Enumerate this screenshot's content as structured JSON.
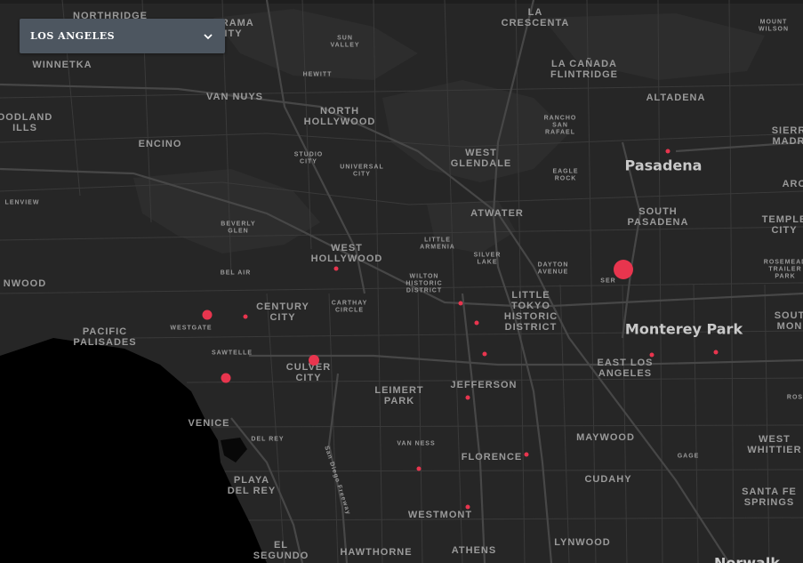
{
  "selector": {
    "value": "LOS ANGELES"
  },
  "colors": {
    "water": "#000000",
    "land": "#262626",
    "road": "#3a3a3a",
    "road_major": "#444444",
    "park": "#2e2e2e",
    "label": "#9a9a9a",
    "label_strong": "#c9c9c9",
    "marker": "#e8354e"
  },
  "labels": [
    {
      "t": "NORTHRIDGE"
    },
    {
      "t": "NORAMA\nCITY"
    },
    {
      "t": "WINNETKA"
    },
    {
      "t": "SUN\nVALLEY"
    },
    {
      "t": "LA\nCRESCENTA"
    },
    {
      "t": "MOUNT\nWILSON"
    },
    {
      "t": "HEWITT"
    },
    {
      "t": "VAN NUYS"
    },
    {
      "t": "LA CAÑADA\nFLINTRIDGE"
    },
    {
      "t": "ALTADENA"
    },
    {
      "t": "OODLAND\nILLS"
    },
    {
      "t": "NORTH\nHOLLYWOOD"
    },
    {
      "t": "RANCHO\nSAN\nRAFAEL"
    },
    {
      "t": "SIERR\nMADR"
    },
    {
      "t": "ENCINO"
    },
    {
      "t": "STUDIO\nCITY"
    },
    {
      "t": "UNIVERSAL\nCITY"
    },
    {
      "t": "WEST\nGLENDALE"
    },
    {
      "t": "Pasadena"
    },
    {
      "t": "EAGLE\nROCK"
    },
    {
      "t": "ARC"
    },
    {
      "t": "LENVIEW"
    },
    {
      "t": "ATWATER"
    },
    {
      "t": "SOUTH\nPASADENA"
    },
    {
      "t": "TEMPLE\nCITY"
    },
    {
      "t": "BEVERLY\nGLEN"
    },
    {
      "t": "LITTLE\nARMENIA"
    },
    {
      "t": "WEST\nHOLLYWOOD"
    },
    {
      "t": "SILVER\nLAKE"
    },
    {
      "t": "DAYTON\nAVENUE"
    },
    {
      "t": "ROSEMEAD\nTRAILER\nPARK"
    },
    {
      "t": "BEL AIR"
    },
    {
      "t": "NWOOD"
    },
    {
      "t": "WILTON\nHISTORIC\nDISTRICT"
    },
    {
      "t": "SER"
    },
    {
      "t": "CENTURY\nCITY"
    },
    {
      "t": "CARTHAY\nCIRCLE"
    },
    {
      "t": "LITTLE\nTOKYO\nHISTORIC\nDISTRICT"
    },
    {
      "t": "Monterey Park"
    },
    {
      "t": "SOUT\nMON"
    },
    {
      "t": "PACIFIC\nPALISADES"
    },
    {
      "t": "WESTGATE"
    },
    {
      "t": "SAWTELLE"
    },
    {
      "t": "CULVER\nCITY"
    },
    {
      "t": "EAST LOS\nANGELES"
    },
    {
      "t": "JEFFERSON"
    },
    {
      "t": "LEIMERT\nPARK"
    },
    {
      "t": "ROS"
    },
    {
      "t": "VENICE"
    },
    {
      "t": "DEL REY"
    },
    {
      "t": "MAYWOOD"
    },
    {
      "t": "VAN NESS"
    },
    {
      "t": "WEST\nWHITTIER"
    },
    {
      "t": "FLORENCE"
    },
    {
      "t": "GAGE"
    },
    {
      "t": "San Diego Freeway"
    },
    {
      "t": "CUDAHY"
    },
    {
      "t": "PLAYA\nDEL REY"
    },
    {
      "t": "SANTA FE\nSPRINGS"
    },
    {
      "t": "WESTMONT"
    },
    {
      "t": "LYNWOOD"
    },
    {
      "t": "EL\nSEGUNDO"
    },
    {
      "t": "HAWTHORNE"
    },
    {
      "t": "ATHENS"
    },
    {
      "t": "Norwalk"
    }
  ],
  "markers_count": 17
}
